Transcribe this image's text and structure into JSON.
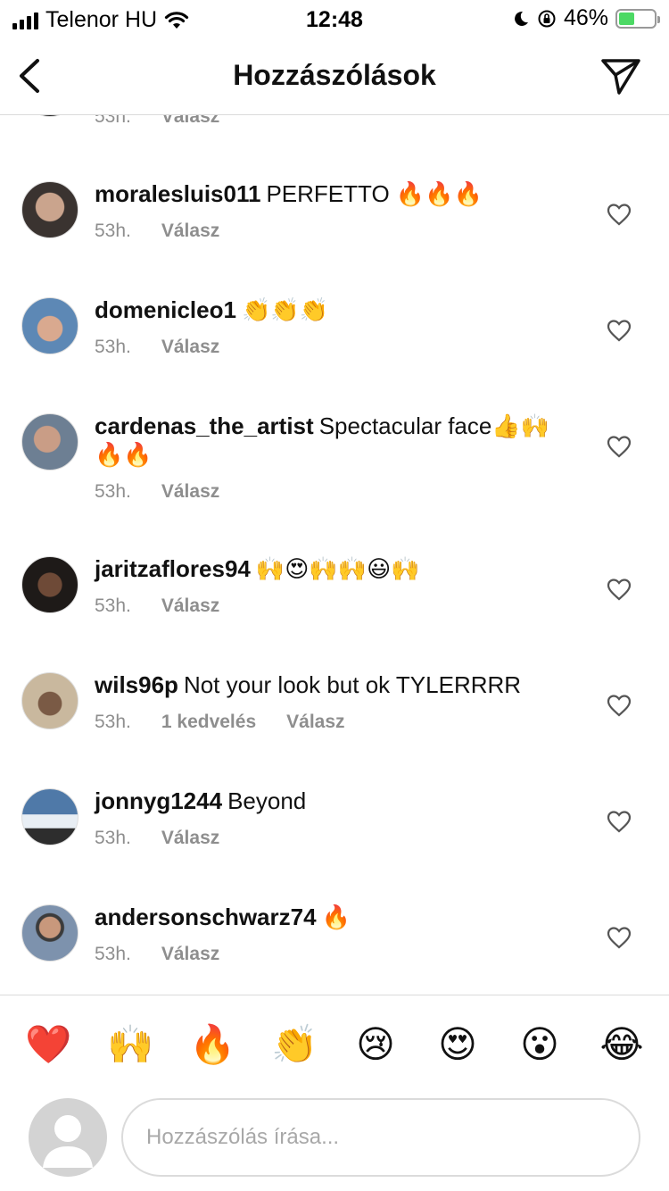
{
  "status_bar": {
    "carrier": "Telenor HU",
    "time": "12:48",
    "battery": "46%",
    "battery_level": 0.46
  },
  "header": {
    "title": "Hozzászólások"
  },
  "partial_comment": {
    "time": "53h.",
    "reply_label": "Válasz"
  },
  "comments": [
    {
      "username": "moralesluis011",
      "text": "PERFETTO 🔥🔥🔥",
      "time": "53h.",
      "likes": "",
      "reply_label": "Válasz"
    },
    {
      "username": "domenicleo1",
      "text": "👏👏👏",
      "time": "53h.",
      "likes": "",
      "reply_label": "Válasz"
    },
    {
      "username": "cardenas_the_artist",
      "text": "Spectacular face👍🙌🔥🔥",
      "time": "53h.",
      "likes": "",
      "reply_label": "Válasz"
    },
    {
      "username": "jaritzaflores94",
      "text": "🙌😍🙌🙌😃🙌",
      "time": "53h.",
      "likes": "",
      "reply_label": "Válasz"
    },
    {
      "username": "wils96p",
      "text": "Not your look but ok TYLERRRR",
      "time": "53h.",
      "likes": "1 kedvelés",
      "reply_label": "Válasz"
    },
    {
      "username": "jonnyg1244",
      "text": "Beyond",
      "time": "53h.",
      "likes": "",
      "reply_label": "Válasz"
    },
    {
      "username": "andersonschwarz74",
      "text": "🔥",
      "time": "53h.",
      "likes": "",
      "reply_label": "Válasz"
    }
  ],
  "emoji_bar": [
    "❤️",
    "🙌",
    "🔥",
    "👏",
    "😢",
    "😍",
    "😮",
    "😂"
  ],
  "composer": {
    "placeholder": "Hozzászólás írása..."
  }
}
